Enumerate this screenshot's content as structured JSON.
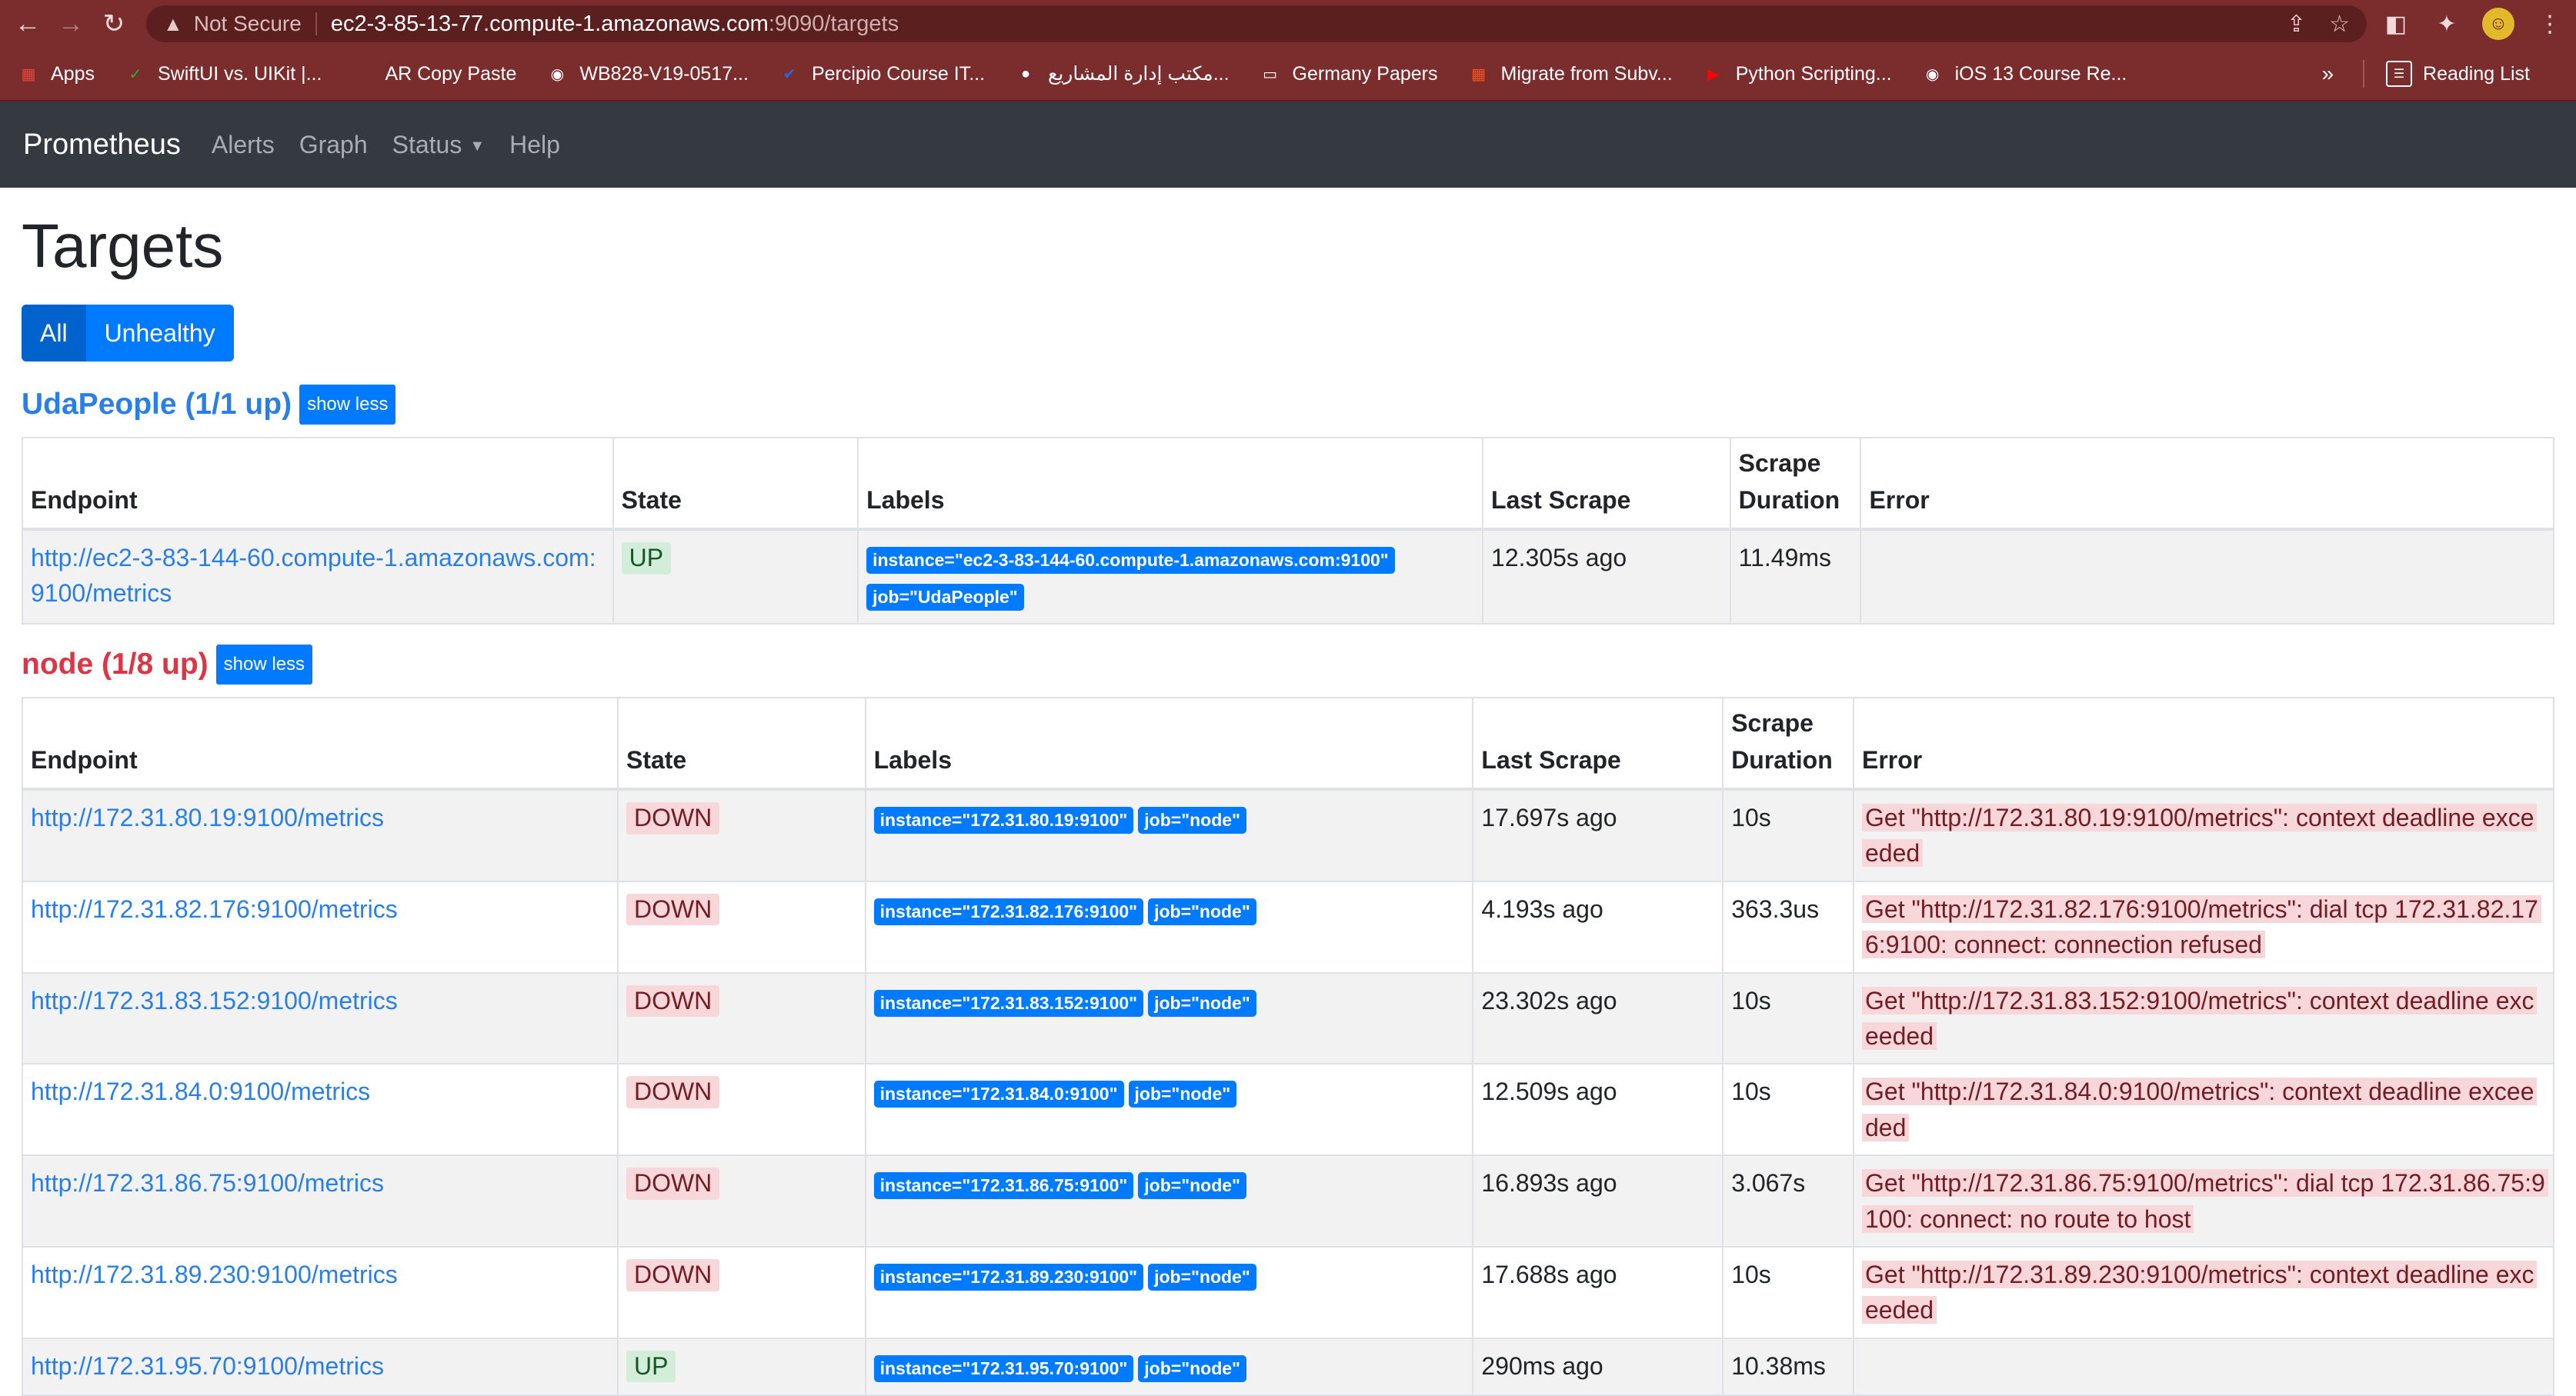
{
  "browser": {
    "not_secure": "Not Secure",
    "url_host": "ec2-3-85-13-77.compute-1.amazonaws.com",
    "url_path": ":9090/targets",
    "bookmarks": [
      {
        "label": "Apps",
        "icon": "apps-grid-icon",
        "color": "#e8453c"
      },
      {
        "label": "SwiftUI vs. UIKit |...",
        "icon": "swiftui-icon",
        "color": "#3ba745"
      },
      {
        "label": "AR Copy Paste",
        "icon": "dots-icon",
        "color": "#7a2d2c"
      },
      {
        "label": "WB828-V19-0517...",
        "icon": "circle-logo-icon",
        "color": "#ffffff"
      },
      {
        "label": "Percipio Course IT...",
        "icon": "percipio-icon",
        "color": "#2f63d8"
      },
      {
        "label": "مكتب إدارة المشاريع...",
        "icon": "globe-icon",
        "color": "#ffffff"
      },
      {
        "label": "Germany Papers",
        "icon": "folder-icon",
        "color": "#ffffff"
      },
      {
        "label": "Migrate from Subv...",
        "icon": "microsoft-icon",
        "color": "#f35325"
      },
      {
        "label": "Python Scripting...",
        "icon": "youtube-icon",
        "color": "#ff0000"
      },
      {
        "label": "iOS 13 Course Re...",
        "icon": "udemy-icon",
        "color": "#ffffff"
      }
    ],
    "overflow": "»",
    "reading_list": "Reading List"
  },
  "navbar": {
    "brand": "Prometheus",
    "links": [
      "Alerts",
      "Graph",
      "Status",
      "Help"
    ]
  },
  "page": {
    "title": "Targets",
    "filter_all": "All",
    "filter_unhealthy": "Unhealthy"
  },
  "columns": [
    "Endpoint",
    "State",
    "Labels",
    "Last Scrape",
    "Scrape Duration",
    "Error"
  ],
  "pools": [
    {
      "name": "UdaPeople (1/1 up)",
      "toggle": "show less",
      "healthy": true,
      "targets": [
        {
          "endpoint": "http://ec2-3-83-144-60.compute-1.amazonaws.com:9100/metrics",
          "state": "UP",
          "labels": [
            "instance=\"ec2-3-83-144-60.compute-1.amazonaws.com:9100\"",
            "job=\"UdaPeople\""
          ],
          "last_scrape": "12.305s ago",
          "duration": "11.49ms",
          "error": ""
        }
      ]
    },
    {
      "name": "node (1/8 up)",
      "toggle": "show less",
      "healthy": false,
      "targets": [
        {
          "endpoint": "http://172.31.80.19:9100/metrics",
          "state": "DOWN",
          "labels": [
            "instance=\"172.31.80.19:9100\"",
            "job=\"node\""
          ],
          "last_scrape": "17.697s ago",
          "duration": "10s",
          "error": "Get \"http://172.31.80.19:9100/metrics\": context deadline exceeded"
        },
        {
          "endpoint": "http://172.31.82.176:9100/metrics",
          "state": "DOWN",
          "labels": [
            "instance=\"172.31.82.176:9100\"",
            "job=\"node\""
          ],
          "last_scrape": "4.193s ago",
          "duration": "363.3us",
          "error": "Get \"http://172.31.82.176:9100/metrics\": dial tcp 172.31.82.176:9100: connect: connection refused"
        },
        {
          "endpoint": "http://172.31.83.152:9100/metrics",
          "state": "DOWN",
          "labels": [
            "instance=\"172.31.83.152:9100\"",
            "job=\"node\""
          ],
          "last_scrape": "23.302s ago",
          "duration": "10s",
          "error": "Get \"http://172.31.83.152:9100/metrics\": context deadline exceeded"
        },
        {
          "endpoint": "http://172.31.84.0:9100/metrics",
          "state": "DOWN",
          "labels": [
            "instance=\"172.31.84.0:9100\"",
            "job=\"node\""
          ],
          "last_scrape": "12.509s ago",
          "duration": "10s",
          "error": "Get \"http://172.31.84.0:9100/metrics\": context deadline exceeded"
        },
        {
          "endpoint": "http://172.31.86.75:9100/metrics",
          "state": "DOWN",
          "labels": [
            "instance=\"172.31.86.75:9100\"",
            "job=\"node\""
          ],
          "last_scrape": "16.893s ago",
          "duration": "3.067s",
          "error": "Get \"http://172.31.86.75:9100/metrics\": dial tcp 172.31.86.75:9100: connect: no route to host"
        },
        {
          "endpoint": "http://172.31.89.230:9100/metrics",
          "state": "DOWN",
          "labels": [
            "instance=\"172.31.89.230:9100\"",
            "job=\"node\""
          ],
          "last_scrape": "17.688s ago",
          "duration": "10s",
          "error": "Get \"http://172.31.89.230:9100/metrics\": context deadline exceeded"
        },
        {
          "endpoint": "http://172.31.95.70:9100/metrics",
          "state": "UP",
          "labels": [
            "instance=\"172.31.95.70:9100\"",
            "job=\"node\""
          ],
          "last_scrape": "290ms ago",
          "duration": "10.38ms",
          "error": ""
        }
      ]
    }
  ]
}
